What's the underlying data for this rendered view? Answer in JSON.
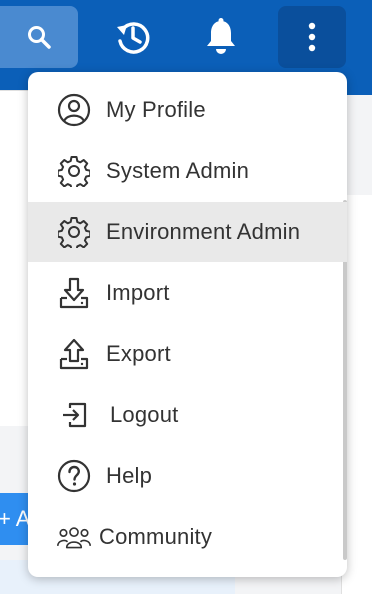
{
  "toolbar": {
    "search_icon": "search-icon",
    "history_icon": "history-icon",
    "notifications_icon": "bell-icon",
    "more_icon": "more-vertical-icon",
    "brand_color": "#0b5fb8"
  },
  "background": {
    "add_button_label": "+ A"
  },
  "menu": {
    "items": [
      {
        "label": "My Profile",
        "icon": "user-circle-icon"
      },
      {
        "label": "System Admin",
        "icon": "gear-icon"
      },
      {
        "label": "Environment Admin",
        "icon": "gear-icon",
        "active": true
      },
      {
        "label": "Import",
        "icon": "import-icon"
      },
      {
        "label": "Export",
        "icon": "export-icon"
      },
      {
        "label": "Logout",
        "icon": "logout-icon"
      },
      {
        "label": "Help",
        "icon": "help-icon"
      },
      {
        "label": "Community",
        "icon": "community-icon"
      }
    ]
  }
}
